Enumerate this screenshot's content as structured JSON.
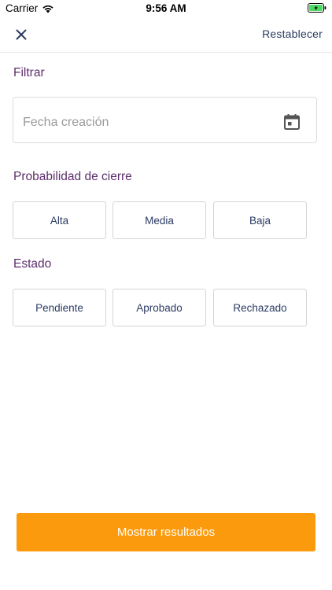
{
  "status_bar": {
    "carrier": "Carrier",
    "time": "9:56 AM"
  },
  "nav": {
    "close_icon": "close-icon",
    "reset_label": "Restablecer"
  },
  "filter": {
    "title": "Filtrar",
    "date_placeholder": "Fecha creación",
    "date_icon": "calendar-icon"
  },
  "probability": {
    "title": "Probabilidad de cierre",
    "options": [
      "Alta",
      "Media",
      "Baja"
    ]
  },
  "status": {
    "title": "Estado",
    "options": [
      "Pendiente",
      "Aprobado",
      "Rechazado"
    ]
  },
  "footer": {
    "button_label": "Mostrar resultados"
  },
  "colors": {
    "accent": "#fb9a0c",
    "section_title": "#5c2d6b",
    "text_primary": "#2b3b63",
    "battery": "#4cd964"
  }
}
